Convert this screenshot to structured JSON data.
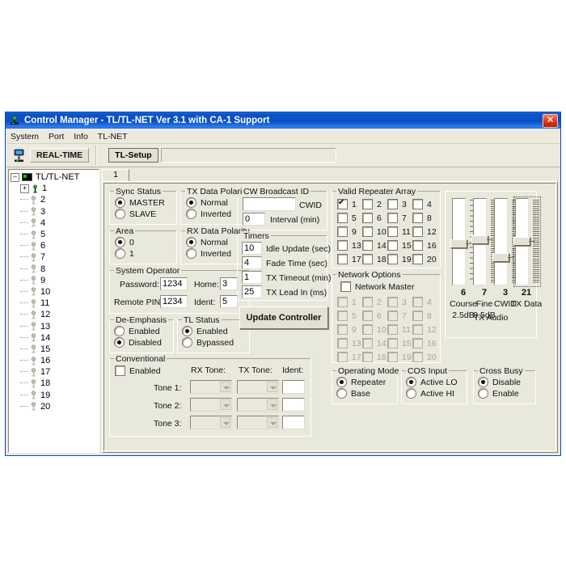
{
  "window": {
    "title": "Control Manager - TL/TL-NET Ver 3.1 with CA-1 Support",
    "close_label": "✕",
    "accent": "#0050e0",
    "face": "#e9e8dc"
  },
  "menu": {
    "items": [
      "System",
      "Port",
      "Info",
      "TL-NET"
    ]
  },
  "toolbar": {
    "realtime_label": "REAL-TIME",
    "setup_label": "TL-Setup",
    "setup_field_value": ""
  },
  "tree": {
    "root_label": "TL/TL-NET",
    "nodes": [
      "1",
      "2",
      "3",
      "4",
      "5",
      "6",
      "7",
      "8",
      "9",
      "10",
      "11",
      "12",
      "13",
      "14",
      "15",
      "16",
      "17",
      "18",
      "19",
      "20"
    ]
  },
  "tabs": [
    {
      "label": "1"
    }
  ],
  "sync_status": {
    "caption": "Sync Status",
    "options": [
      "MASTER",
      "SLAVE"
    ],
    "selected": "MASTER"
  },
  "area": {
    "caption": "Area",
    "options": [
      "0",
      "1"
    ],
    "selected": "0"
  },
  "tx_data_polarity": {
    "caption": "TX Data Polarity",
    "options": [
      "Normal",
      "Inverted"
    ],
    "selected": "Normal"
  },
  "rx_data_polarity": {
    "caption": "RX Data Polarity",
    "options": [
      "Normal",
      "Inverted"
    ],
    "selected": "Normal"
  },
  "system_operator": {
    "caption": "System Operator",
    "password_label": "Password:",
    "password_value": "1234",
    "home_label": "Home:",
    "home_value": "3",
    "remote_pin_label": "Remote PIN:",
    "remote_pin_value": "1234",
    "ident_label": "Ident:",
    "ident_value": "5"
  },
  "de_emphasis": {
    "caption": "De-Emphasis",
    "options": [
      "Enabled",
      "Disabled"
    ],
    "selected": "Disabled"
  },
  "tl_status": {
    "caption": "TL Status",
    "options": [
      "Enabled",
      "Bypassed"
    ],
    "selected": "Enabled"
  },
  "conventional": {
    "caption": "Conventional",
    "enabled_label": "Enabled",
    "enabled_checked": false,
    "col_rx": "RX Tone:",
    "col_tx": "TX Tone:",
    "col_ident": "Ident:",
    "rows": [
      {
        "label": "Tone 1:",
        "rx": "",
        "tx": "",
        "ident": ""
      },
      {
        "label": "Tone 2:",
        "rx": "",
        "tx": "",
        "ident": ""
      },
      {
        "label": "Tone 3:",
        "rx": "",
        "tx": "",
        "ident": ""
      }
    ]
  },
  "cw_broadcast": {
    "caption": "CW Broadcast ID",
    "cwid_value": "",
    "cwid_label": "CWID",
    "interval_value": "0",
    "interval_label": "Interval (min)"
  },
  "timers": {
    "caption": "Timers",
    "rows": [
      {
        "value": "10",
        "label": "Idle Update (sec)"
      },
      {
        "value": "4",
        "label": "Fade Time (sec)"
      },
      {
        "value": "1",
        "label": "TX Timeout (min)"
      },
      {
        "value": "25",
        "label": "TX Lead In (ms)"
      }
    ]
  },
  "update_button": {
    "label": "Update Controller"
  },
  "valid_repeater_array": {
    "caption": "Valid Repeater Array",
    "items": [
      {
        "n": "1",
        "on": true
      },
      {
        "n": "2",
        "on": false
      },
      {
        "n": "3",
        "on": false
      },
      {
        "n": "4",
        "on": false
      },
      {
        "n": "5",
        "on": false
      },
      {
        "n": "6",
        "on": false
      },
      {
        "n": "7",
        "on": false
      },
      {
        "n": "8",
        "on": false
      },
      {
        "n": "9",
        "on": false
      },
      {
        "n": "10",
        "on": false
      },
      {
        "n": "11",
        "on": false
      },
      {
        "n": "12",
        "on": false
      },
      {
        "n": "13",
        "on": false
      },
      {
        "n": "14",
        "on": false
      },
      {
        "n": "15",
        "on": false
      },
      {
        "n": "16",
        "on": false
      },
      {
        "n": "17",
        "on": false
      },
      {
        "n": "18",
        "on": false
      },
      {
        "n": "19",
        "on": false
      },
      {
        "n": "20",
        "on": false
      }
    ]
  },
  "network_options": {
    "caption": "Network Options",
    "master_label": "Network Master",
    "master_checked": false,
    "disabled": true,
    "items": [
      {
        "n": "1",
        "on": false
      },
      {
        "n": "2",
        "on": false
      },
      {
        "n": "3",
        "on": false
      },
      {
        "n": "4",
        "on": false
      },
      {
        "n": "5",
        "on": false
      },
      {
        "n": "6",
        "on": false
      },
      {
        "n": "7",
        "on": false
      },
      {
        "n": "8",
        "on": false
      },
      {
        "n": "9",
        "on": false
      },
      {
        "n": "10",
        "on": false
      },
      {
        "n": "11",
        "on": false
      },
      {
        "n": "12",
        "on": false
      },
      {
        "n": "13",
        "on": false
      },
      {
        "n": "14",
        "on": false
      },
      {
        "n": "15",
        "on": false
      },
      {
        "n": "16",
        "on": false
      },
      {
        "n": "17",
        "on": false
      },
      {
        "n": "18",
        "on": false
      },
      {
        "n": "19",
        "on": false
      },
      {
        "n": "20",
        "on": false
      }
    ]
  },
  "operating_mode": {
    "caption": "Operating Mode",
    "options": [
      "Repeater",
      "Base"
    ],
    "selected": "Repeater"
  },
  "cos_input": {
    "caption": "COS Input",
    "options": [
      "Active LO",
      "Active HI"
    ],
    "selected": "Active LO"
  },
  "cross_busy": {
    "caption": "Cross Busy",
    "options": [
      "Disable",
      "Enable"
    ],
    "selected": "Disable"
  },
  "tx_audio": {
    "group_label": "TX Audio",
    "sliders": [
      {
        "name": "Course",
        "value": "6",
        "db": "2.5dB",
        "pct": 0.46,
        "fine": false,
        "focused": false
      },
      {
        "name": "Fine",
        "value": "7",
        "db": "0.5dB",
        "pct": 0.52,
        "fine": true,
        "focused": false
      },
      {
        "name": "CWID",
        "value": "3",
        "db": "",
        "pct": 0.28,
        "fine": true,
        "focused": false
      },
      {
        "name": "TX Data",
        "value": "21",
        "db": "",
        "pct": 0.49,
        "fine": true,
        "focused": true
      }
    ]
  }
}
